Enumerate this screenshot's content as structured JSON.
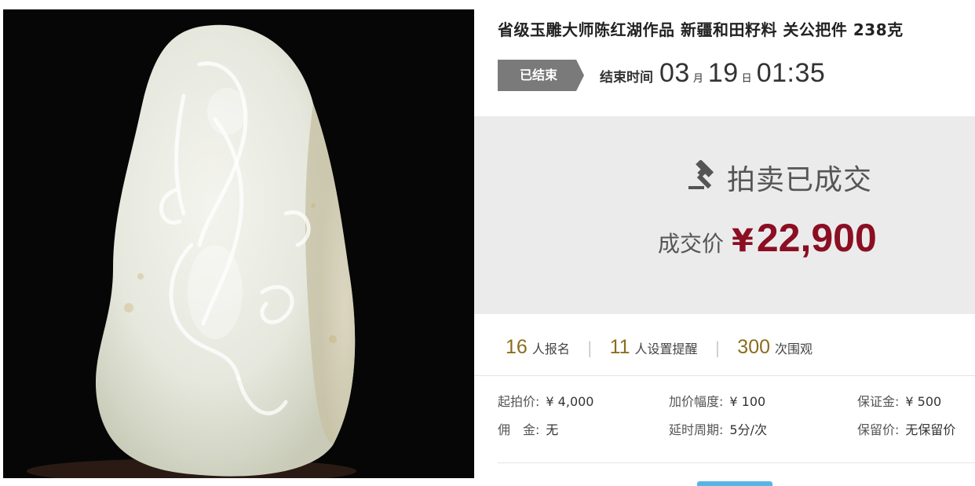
{
  "product": {
    "title": "省级玉雕大师陈红湖作品 新疆和田籽料 关公把件 238克",
    "image_alt": "jade-carving-guangong"
  },
  "status": {
    "tag": "已结束",
    "end_label": "结束时间",
    "month": "03",
    "month_unit": "月",
    "day": "19",
    "day_unit": "日",
    "time": "01:35"
  },
  "result": {
    "icon": "gavel-icon",
    "sold_text": "拍卖已成交",
    "price_label": "成交价",
    "currency": "¥",
    "price": "22,900"
  },
  "stats": [
    {
      "num": "16",
      "label": "人报名"
    },
    {
      "num": "11",
      "label": "人设置提醒"
    },
    {
      "num": "300",
      "label": "次围观"
    }
  ],
  "details": {
    "start_price": {
      "label": "起拍价:",
      "value": "¥ 4,000"
    },
    "increment": {
      "label": "加价幅度:",
      "value": "¥ 100"
    },
    "deposit": {
      "label": "保证金:",
      "value": "¥ 500"
    },
    "commission": {
      "label": "佣　金:",
      "value": "无"
    },
    "extension": {
      "label": "延时周期:",
      "value": "5分/次"
    },
    "reserve": {
      "label": "保留价:",
      "value": "无保留价"
    }
  },
  "colors": {
    "price_red": "#8b0e22",
    "stat_gold": "#8a6d1e",
    "tag_gray": "#7a7a7a",
    "panel_bg": "#ebebeb"
  }
}
